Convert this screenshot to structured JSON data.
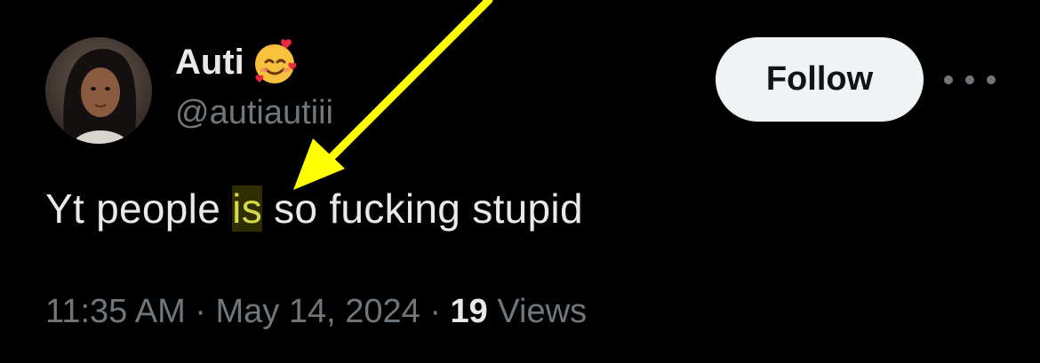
{
  "tweet": {
    "author": {
      "display_name": "Auti",
      "emoji": "smiling-face-with-hearts",
      "handle": "@autiautiii"
    },
    "follow_label": "Follow",
    "text_before": "Yt people ",
    "text_highlight": "is",
    "text_after": " so fucking stupid",
    "timestamp": "11:35 AM · May 14, 2024 · ",
    "views_count": "19",
    "views_label": " Views"
  },
  "annotation": {
    "type": "arrow",
    "color": "#ffff00"
  }
}
